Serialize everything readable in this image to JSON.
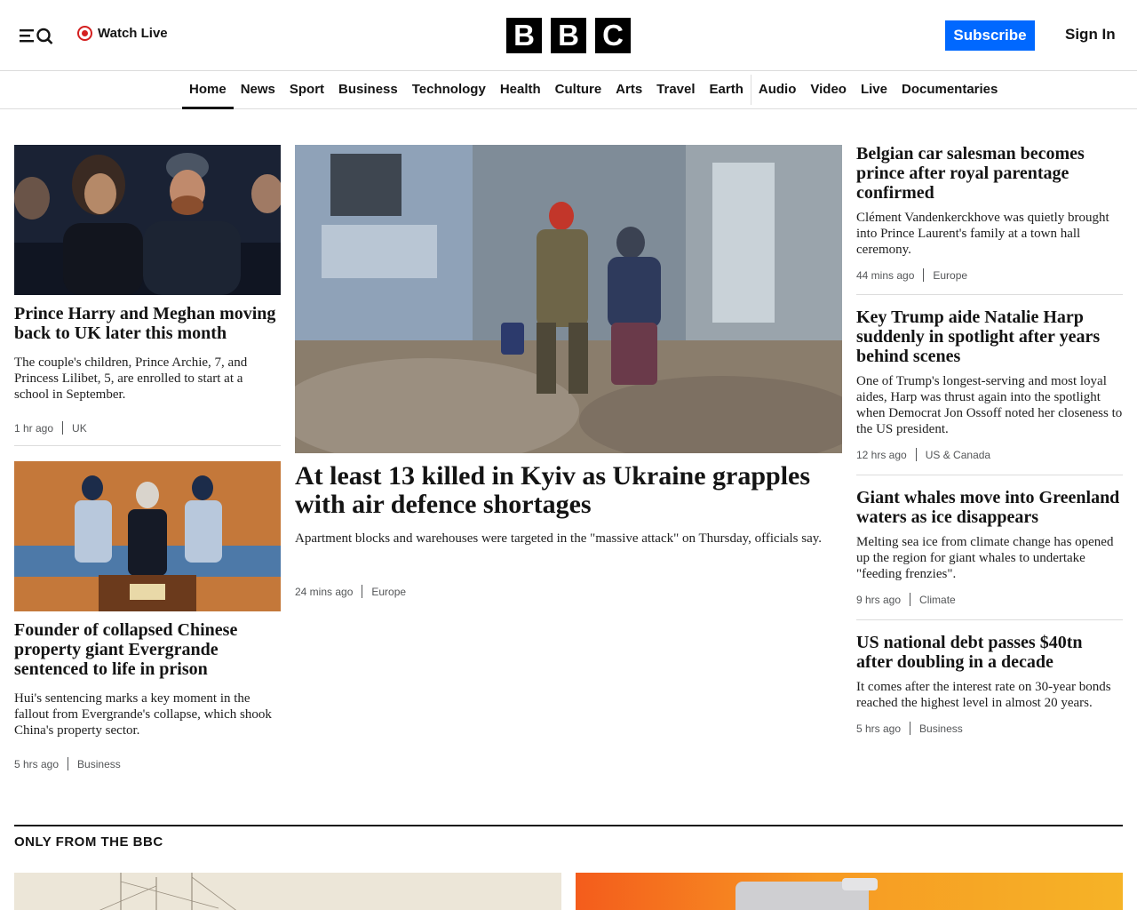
{
  "header": {
    "watch_live": "Watch Live",
    "logo_letters": [
      "B",
      "B",
      "C"
    ],
    "subscribe": "Subscribe",
    "sign_in": "Sign In"
  },
  "nav": {
    "items": [
      "Home",
      "News",
      "Sport",
      "Business",
      "Technology",
      "Health",
      "Culture",
      "Arts",
      "Travel",
      "Earth",
      "Audio",
      "Video",
      "Live",
      "Documentaries"
    ],
    "active": "Home"
  },
  "left": {
    "story1": {
      "headline": "Prince Harry and Meghan moving back to UK later this month",
      "summary": "The couple's children, Prince Archie, 7, and Princess Lilibet, 5, are enrolled to start at a school in September.",
      "time": "1 hr ago",
      "section": "UK"
    },
    "story2": {
      "headline": "Founder of collapsed Chinese property giant Evergrande sentenced to life in prison",
      "summary": "Hui's sentencing marks a key moment in the fallout from Evergrande's collapse, which shook China's property sector.",
      "time": "5 hrs ago",
      "section": "Business"
    }
  },
  "center": {
    "headline": "At least 13 killed in Kyiv as Ukraine grapples with air defence shortages",
    "summary": "Apartment blocks and warehouses were targeted in the \"massive attack\" on Thursday, officials say.",
    "time": "24 mins ago",
    "section": "Europe"
  },
  "right": {
    "stories": [
      {
        "headline": "Belgian car salesman becomes prince after royal parentage confirmed",
        "summary": "Clément Vandenkerckhove was quietly brought into Prince Laurent's family at a town hall ceremony.",
        "time": "44 mins ago",
        "section": "Europe"
      },
      {
        "headline": "Key Trump aide Natalie Harp suddenly in spotlight after years behind scenes",
        "summary": "One of Trump's longest-serving and most loyal aides, Harp was thrust again into the spotlight when Democrat Jon Ossoff noted her closeness to the US president.",
        "time": "12 hrs ago",
        "section": "US & Canada"
      },
      {
        "headline": "Giant whales move into Greenland waters as ice disappears",
        "summary": "Melting sea ice from climate change has opened up the region for giant whales to undertake \"feeding frenzies\".",
        "time": "9 hrs ago",
        "section": "Climate"
      },
      {
        "headline": "US national debt passes $40tn after doubling in a decade",
        "summary": "It comes after the interest rate on 30-year bonds reached the highest level in almost 20 years.",
        "time": "5 hrs ago",
        "section": "Business"
      }
    ]
  },
  "section": {
    "title": "ONLY FROM THE BBC"
  },
  "colors": {
    "accent": "#0068ff",
    "live": "#d42020"
  }
}
